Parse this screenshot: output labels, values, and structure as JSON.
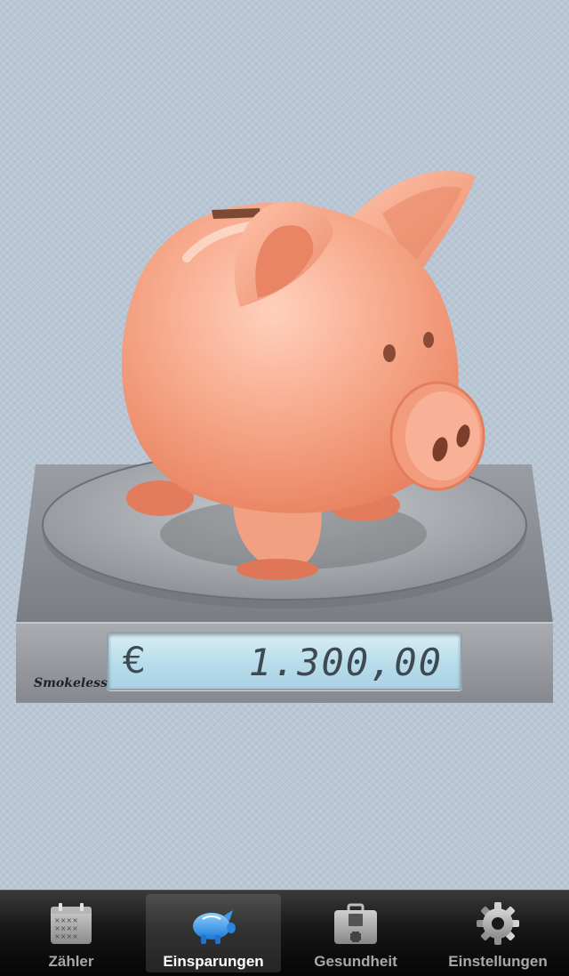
{
  "scale": {
    "currency_symbol": "€",
    "amount": "1.300,00",
    "brand": "Smokeless"
  },
  "tabbar": {
    "active_tab": "Einsparungen",
    "tabs": [
      {
        "label": "Zähler",
        "icon": "calendar-icon"
      },
      {
        "label": "Einsparungen",
        "icon": "piggy-bank-icon"
      },
      {
        "label": "Gesundheit",
        "icon": "medical-kit-icon"
      },
      {
        "label": "Einstellungen",
        "icon": "gear-icon"
      }
    ]
  },
  "colors": {
    "background": "#b9c6d4",
    "piggy": "#f3a486",
    "display": "#b8dcea",
    "active_icon": "#3aa0ee"
  }
}
